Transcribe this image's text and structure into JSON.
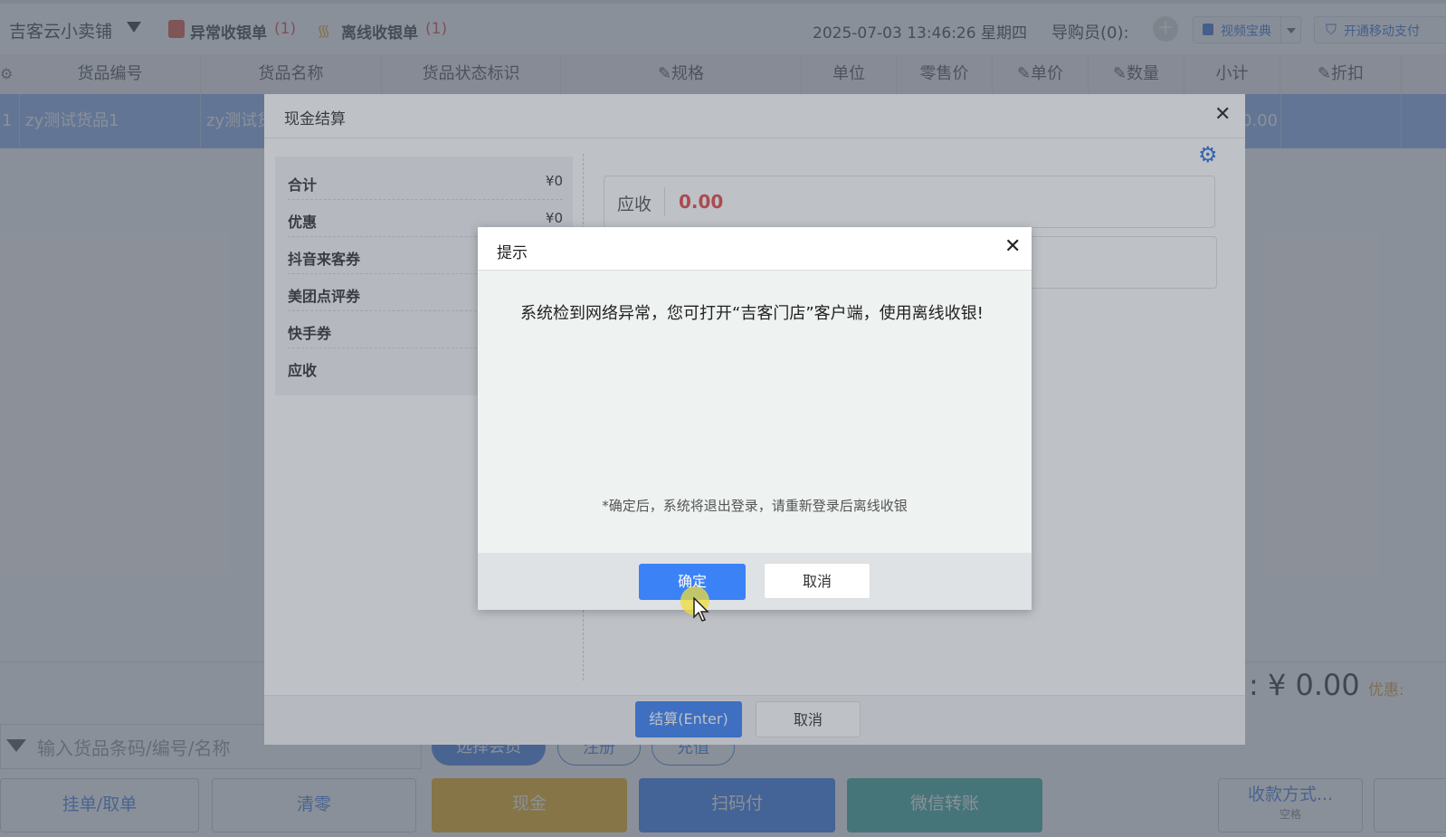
{
  "topbar": {
    "store_name": "吉客云小卖铺",
    "abnormal_label": "异常收银单",
    "abnormal_count": "(1)",
    "offline_label": "离线收银单",
    "offline_count": "(1)",
    "datetime": "2025-07-03 13:46:26 星期四",
    "guide_label": "导购员(0):",
    "video_btn": "视频宝典",
    "mobile_pay_btn": "开通移动支付"
  },
  "table": {
    "headers": [
      "货品编号",
      "货品名称",
      "货品状态标识",
      "✎规格",
      "单位",
      "零售价",
      "✎单价",
      "✎数量",
      "小计",
      "✎折扣"
    ],
    "row": {
      "index": "1",
      "code": "zy测试货品1",
      "name": "zy测试货",
      "subtotal": "0.00"
    }
  },
  "footer": {
    "total": ": ¥ 0.00",
    "discount_label": "优惠:",
    "search_placeholder": "输入货品条码/编号/名称",
    "more": "···",
    "select_member": "选择会员",
    "register": "注册",
    "top_up": "充值",
    "hang_order": "挂单/取单",
    "clear": "清零",
    "cash": "现金",
    "scan_pay": "扫码付",
    "wechat_transfer": "微信转账",
    "pay_method": "收款方式...",
    "pay_method_key": "空格"
  },
  "cash_modal": {
    "title": "现金结算",
    "summary": [
      {
        "label": "合计",
        "value": "¥0"
      },
      {
        "label": "优惠",
        "value": "¥0"
      },
      {
        "label": "抖音来客券",
        "value": ""
      },
      {
        "label": "美团点评券",
        "value": ""
      },
      {
        "label": "快手券",
        "value": ""
      },
      {
        "label": "应收",
        "value": ""
      }
    ],
    "receivable_label": "应收",
    "receivable_value": "0.00",
    "settle_button": "结算(Enter)",
    "cancel_button": "取消"
  },
  "prompt_dialog": {
    "title": "提示",
    "message": "系统检到网络异常，您可打开“吉客门店”客户端，使用离线收银!",
    "note": "*确定后，系统将退出登录，请重新登录后离线收银",
    "ok_button": "确定",
    "cancel_button": "取消"
  },
  "colors": {
    "primary": "#3b82f6",
    "row_highlight": "#8eb2f0",
    "amount_red": "#e04b4b",
    "cash_yellow": "#f1b21a",
    "wechat_teal": "#3fb4a6"
  }
}
